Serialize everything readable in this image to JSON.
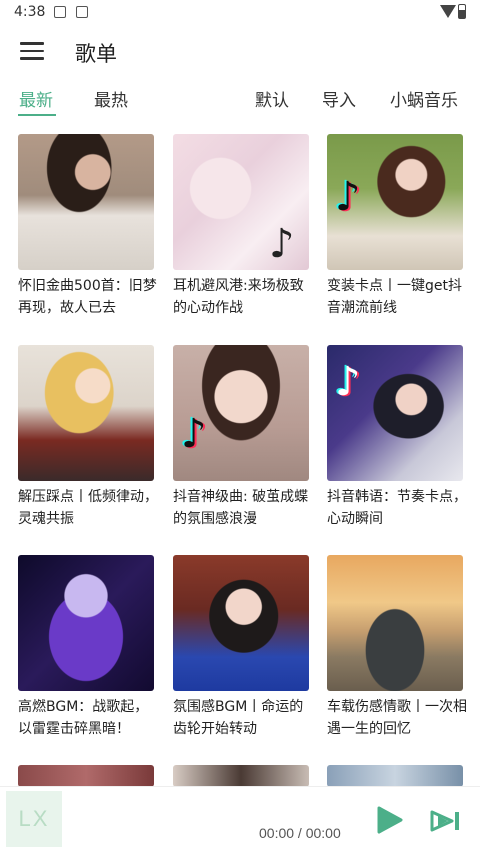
{
  "status_bar": {
    "time": "4:38"
  },
  "header": {
    "title": "歌单"
  },
  "tabs": [
    {
      "label": "最新",
      "active": true
    },
    {
      "label": "最热",
      "active": false
    }
  ],
  "actions": [
    {
      "label": "默认"
    },
    {
      "label": "导入"
    },
    {
      "label": "小蜗音乐"
    }
  ],
  "playlists": [
    {
      "title": "怀旧金曲500首：旧梦再现，故人已去"
    },
    {
      "title": "耳机避风港:来场极致的心动作战"
    },
    {
      "title": "变装卡点丨一键get抖音潮流前线"
    },
    {
      "title": "解压踩点丨低频律动，灵魂共振"
    },
    {
      "title": "抖音神级曲: 破茧成蝶的氛围感浪漫"
    },
    {
      "title": "抖音韩语：节奏卡点，心动瞬间"
    },
    {
      "title": "高燃BGM：战歌起，以雷霆击碎黑暗！"
    },
    {
      "title": "氛围感BGM丨命运的齿轮开始转动"
    },
    {
      "title": "车载伤感情歌丨一次相遇一生的回忆"
    }
  ],
  "player": {
    "logo_text": "LX",
    "time": "00:00 / 00:00"
  },
  "colors": {
    "accent": "#4caf89"
  }
}
